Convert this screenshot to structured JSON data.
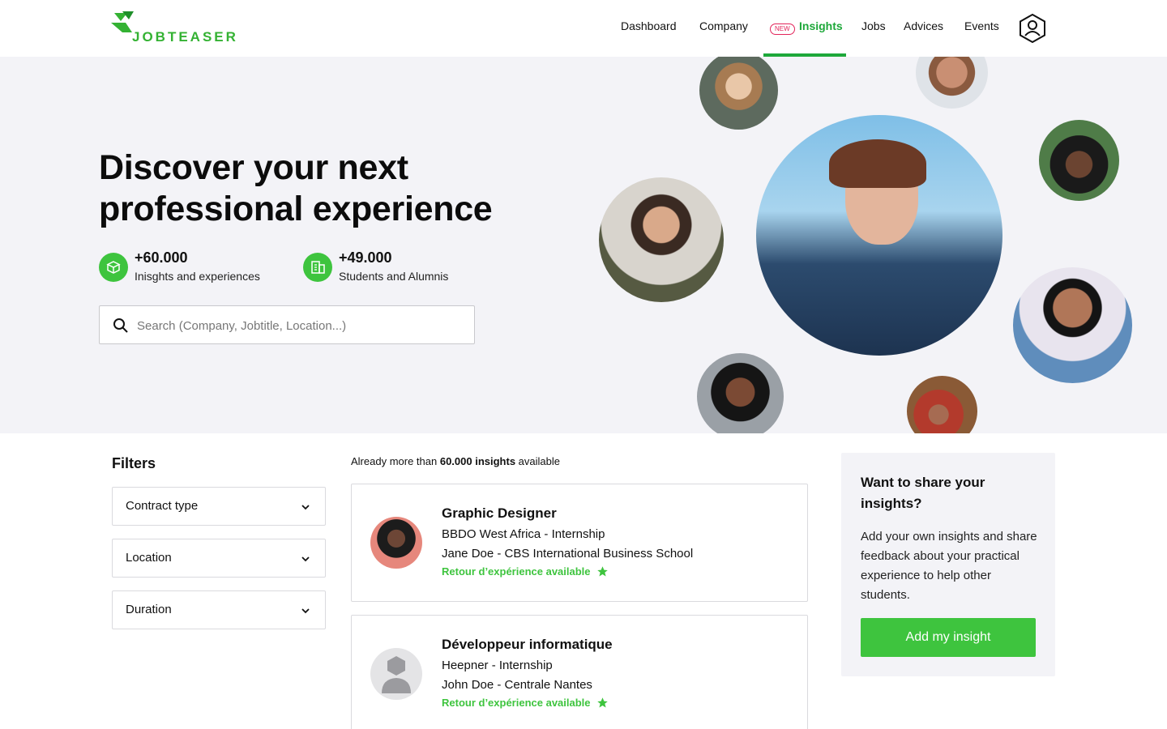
{
  "brand": {
    "name": "JOBTEASER",
    "color": "#34b233"
  },
  "nav": {
    "items": [
      "Dashboard",
      "Company",
      "Insights",
      "Jobs",
      "Advices",
      "Events"
    ],
    "new_badge": "NEW",
    "active": "Insights"
  },
  "hero": {
    "title_line1": "Discover your next",
    "title_line2": "professional experience",
    "stats": [
      {
        "value": "+60.000",
        "label": "Inisghts and experiences",
        "icon": "cube-icon"
      },
      {
        "value": "+49.000",
        "label": "Students and Alumnis",
        "icon": "building-icon"
      }
    ],
    "search_placeholder": "Search (Company, Jobtitle, Location...)"
  },
  "filters": {
    "title": "Filters",
    "items": [
      "Contract type",
      "Location",
      "Duration"
    ]
  },
  "results": {
    "count_prefix": "Already more than ",
    "count_bold": "60.000 insights",
    "count_suffix": " available",
    "cards": [
      {
        "title": "Graphic Designer",
        "company_line": "BBDO West Africa - Internship",
        "author_line": "Jane Doe - CBS International Business School",
        "retour": "Retour d’expérience available"
      },
      {
        "title": "Développeur informatique",
        "company_line": "Heepner - Internship",
        "author_line": "John Doe - Centrale Nantes",
        "retour": "Retour d’expérience available"
      }
    ]
  },
  "share": {
    "title": "Want to share your insights?",
    "text": "Add your own insights and share feedback about your practical experience to help other students.",
    "button": "Add my insight"
  },
  "colors": {
    "accent": "#3ec43e",
    "nav_active": "#1ea83a",
    "badge": "#e2245a",
    "hero_bg": "#f3f3f7"
  }
}
